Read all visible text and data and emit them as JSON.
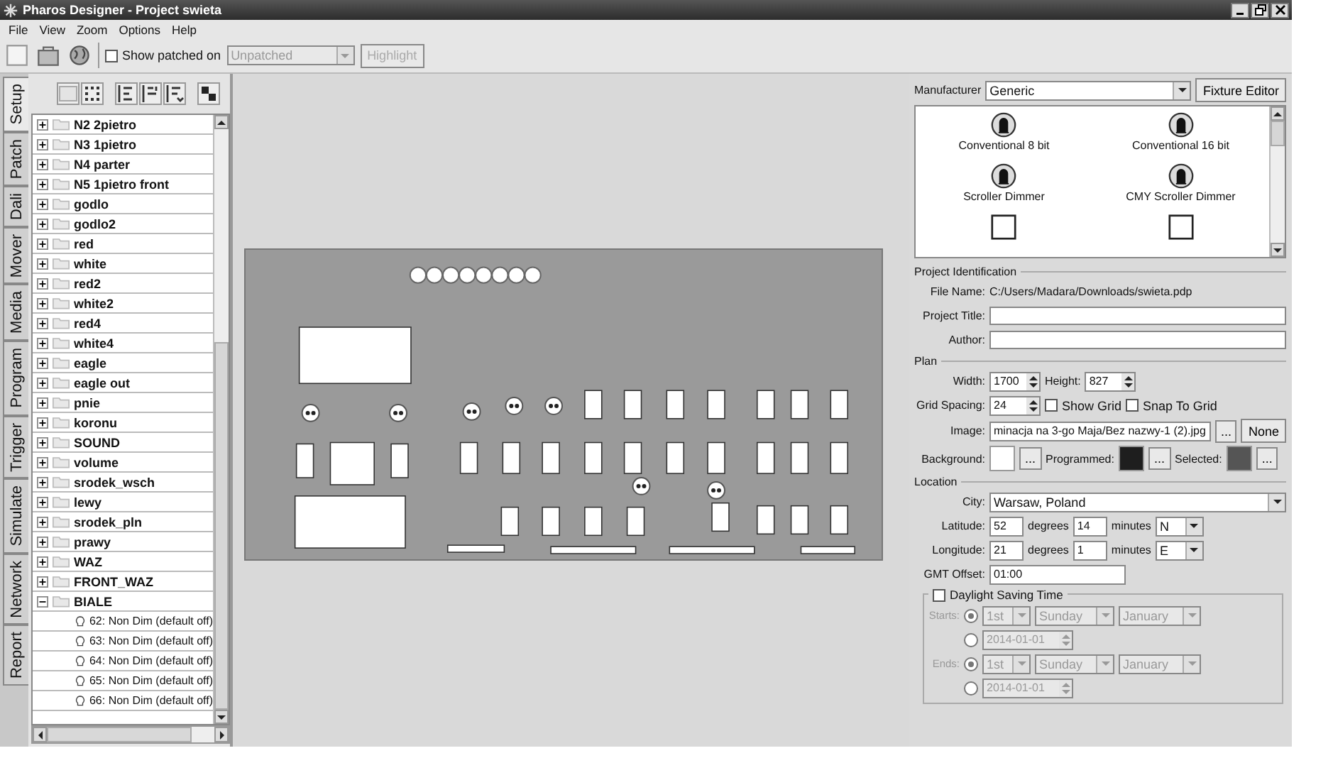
{
  "window": {
    "title": "Pharos Designer - Project swieta"
  },
  "menu": [
    "File",
    "View",
    "Zoom",
    "Options",
    "Help"
  ],
  "toolbar": {
    "show_patched": {
      "label": "Show patched on",
      "checked": false
    },
    "patch_select": {
      "value": "Unpatched",
      "disabled": true
    },
    "highlight": {
      "label": "Highlight",
      "disabled": true
    }
  },
  "side_tabs": [
    {
      "label": "Setup",
      "selected": true
    },
    {
      "label": "Patch",
      "selected": false
    },
    {
      "label": "Dali",
      "selected": false
    },
    {
      "label": "Mover",
      "selected": false
    },
    {
      "label": "Media",
      "selected": false
    },
    {
      "label": "Program",
      "selected": false
    },
    {
      "label": "Trigger",
      "selected": false
    },
    {
      "label": "Simulate",
      "selected": false
    },
    {
      "label": "Network",
      "selected": false
    },
    {
      "label": "Report",
      "selected": false
    }
  ],
  "tree": {
    "items": [
      {
        "label": "N2 2pietro",
        "expanded": false
      },
      {
        "label": "N3 1pietro",
        "expanded": false
      },
      {
        "label": "N4 parter",
        "expanded": false
      },
      {
        "label": "N5 1pietro front",
        "expanded": false
      },
      {
        "label": "godlo",
        "expanded": false
      },
      {
        "label": "godlo2",
        "expanded": false
      },
      {
        "label": "red",
        "expanded": false
      },
      {
        "label": "white",
        "expanded": false
      },
      {
        "label": "red2",
        "expanded": false
      },
      {
        "label": "white2",
        "expanded": false
      },
      {
        "label": "red4",
        "expanded": false
      },
      {
        "label": "white4",
        "expanded": false
      },
      {
        "label": "eagle",
        "expanded": false
      },
      {
        "label": "eagle out",
        "expanded": false
      },
      {
        "label": "pnie",
        "expanded": false
      },
      {
        "label": "koronu",
        "expanded": false
      },
      {
        "label": "SOUND",
        "expanded": false
      },
      {
        "label": "volume",
        "expanded": false
      },
      {
        "label": "srodek_wsch",
        "expanded": false
      },
      {
        "label": "lewy",
        "expanded": false
      },
      {
        "label": "srodek_pln",
        "expanded": false
      },
      {
        "label": "prawy",
        "expanded": false
      },
      {
        "label": "WAZ",
        "expanded": false
      },
      {
        "label": "FRONT_WAZ",
        "expanded": false
      },
      {
        "label": "BIALE",
        "expanded": true,
        "children": [
          {
            "label": "62: Non Dim (default off)"
          },
          {
            "label": "63: Non Dim (default off)"
          },
          {
            "label": "64: Non Dim (default off)"
          },
          {
            "label": "65: Non Dim (default off)"
          },
          {
            "label": "66: Non Dim (default off)"
          }
        ]
      }
    ]
  },
  "fixtures": {
    "manufacturer_label": "Manufacturer",
    "manufacturer": "Generic",
    "editor_button": "Fixture Editor",
    "items": [
      {
        "label": "Conventional 8 bit",
        "kind": "conventional"
      },
      {
        "label": "Conventional 16 bit",
        "kind": "conventional"
      },
      {
        "label": "Scroller Dimmer",
        "kind": "conventional"
      },
      {
        "label": "CMY Scroller Dimmer",
        "kind": "conventional"
      },
      {
        "kind": "led"
      },
      {
        "kind": "led"
      }
    ]
  },
  "project": {
    "title": "Project Identification",
    "file_name": {
      "label": "File Name:",
      "value": "C:/Users/Madara/Downloads/swieta.pdp"
    },
    "project_title": {
      "label": "Project Title:"
    },
    "author": {
      "label": "Author:"
    }
  },
  "plan": {
    "title": "Plan",
    "width": {
      "label": "Width:",
      "value": "1700"
    },
    "height": {
      "label": "Height:",
      "value": "827"
    },
    "grid_spacing": {
      "label": "Grid Spacing:",
      "value": "24"
    },
    "show_grid": {
      "label": "Show Grid",
      "checked": false
    },
    "snap": {
      "label": "Snap To Grid",
      "checked": false
    },
    "image": {
      "label": "Image:",
      "value": "minacja na 3-go Maja/Bez nazwy-1 (2).jpg",
      "browse": "...",
      "none": "None"
    },
    "colors": [
      {
        "label": "Background:",
        "color": "#ffffff",
        "browse": "..."
      },
      {
        "label": "Programmed:",
        "color": "#1e1e1e",
        "browse": "..."
      },
      {
        "label": "Selected:",
        "color": "#555555",
        "browse": "..."
      }
    ]
  },
  "location": {
    "title": "Location",
    "city": {
      "label": "City:",
      "value": "Warsaw, Poland"
    },
    "coords": [
      {
        "label": "Latitude:",
        "degrees": "52",
        "degrees_unit": "degrees",
        "minutes": "14",
        "minutes_unit": "minutes",
        "dir": "N"
      },
      {
        "label": "Longitude:",
        "degrees": "21",
        "degrees_unit": "degrees",
        "minutes": "1",
        "minutes_unit": "minutes",
        "dir": "E"
      }
    ],
    "gmt": {
      "label": "GMT Offset:",
      "value": "01:00"
    }
  },
  "dst": {
    "label": "Daylight Saving Time",
    "checked": false,
    "rows": [
      {
        "label": "Starts:",
        "by_weekday": true,
        "ordinal": "1st",
        "day": "Sunday",
        "month": "January",
        "date": "2014-01-01"
      },
      {
        "label": "Ends:",
        "by_weekday": true,
        "ordinal": "1st",
        "day": "Sunday",
        "month": "January",
        "date": "2014-01-01"
      }
    ]
  }
}
